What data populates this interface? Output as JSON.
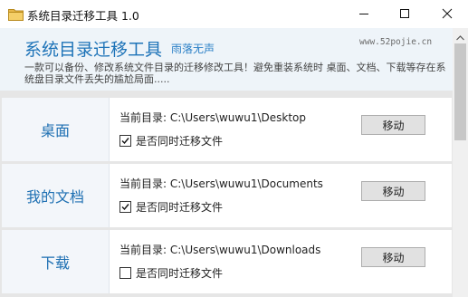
{
  "window": {
    "title": "系统目录迁移工具 1.0",
    "icon": "folder-icon",
    "controls": [
      "minimize-icon",
      "maximize-icon",
      "close-icon"
    ]
  },
  "header": {
    "app_title": "系统目录迁移工具",
    "author": "雨落无声",
    "site": "www.52pojie.cn",
    "description": "一款可以备份、修改系统文件目录的迁移修改工具！避免重装系统时 桌面、文档、下载等存在系统盘目录文件丢失的尴尬局面....."
  },
  "items": [
    {
      "name": "桌面",
      "path_label": "当前目录:",
      "path": "C:\\Users\\wuwu1\\Desktop",
      "checkbox_label": "是否同时迁移文件",
      "checked": true,
      "button": "移动"
    },
    {
      "name": "我的文档",
      "path_label": "当前目录:",
      "path": "C:\\Users\\wuwu1\\Documents",
      "checkbox_label": "是否同时迁移文件",
      "checked": true,
      "button": "移动"
    },
    {
      "name": "下载",
      "path_label": "当前目录:",
      "path": "C:\\Users\\wuwu1\\Downloads",
      "checkbox_label": "是否同时迁移文件",
      "checked": false,
      "button": "移动"
    }
  ],
  "colors": {
    "accent": "#1d73b8",
    "header_bg": "#eef4f9",
    "content_bg": "#e6e6e6"
  }
}
